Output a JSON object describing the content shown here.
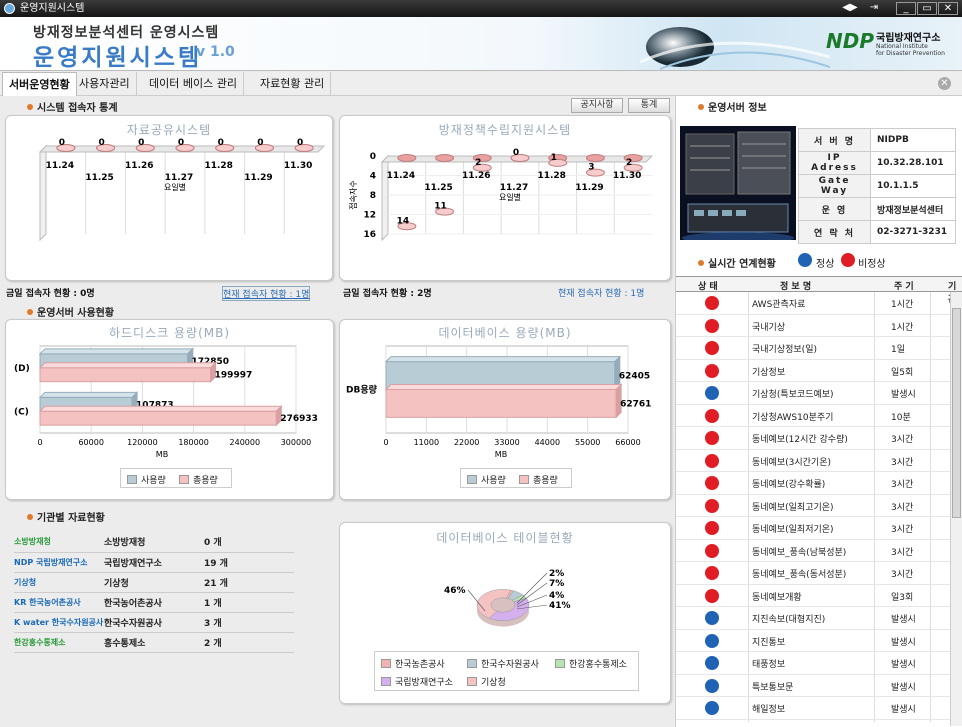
{
  "window": {
    "title": "운영지원시스템",
    "controls": [
      "◀▶",
      "⇥",
      "_",
      "▭",
      "✕"
    ]
  },
  "header": {
    "subtitle": "방재정보분석센터 운영시스템",
    "title": "운영지원시스템",
    "version": "v 1.0",
    "logo_text": "NDP",
    "org_ko": "국립방재연구소",
    "org_en1": "National Institute",
    "org_en2": "for Disaster Prevention"
  },
  "tabs": [
    "서버운영현황",
    "사용자관리",
    "데이터 베이스 관리",
    "자료현황 관리"
  ],
  "access": {
    "section": "시스템 접속자 통계",
    "btn_notice": "공지사항",
    "btn_stats": "통계",
    "left_today": "금일 접속자 현황 : 0명",
    "left_current": "현재 접속자 현황 : 1명",
    "right_today": "금일 접속자 현황 : 2명",
    "right_current": "현재 접속자 현황 : 1명"
  },
  "usage": {
    "section": "운영서버 사용현황"
  },
  "orgs_section": "기관별 자료현황",
  "orgs": [
    {
      "logo": "소방방재청",
      "name": "소방방재청",
      "count": "0 개",
      "color": "#2a9a3a"
    },
    {
      "logo": "NDP 국립방재연구소",
      "name": "국립방재연구소",
      "count": "19 개",
      "color": "#1a6ab5"
    },
    {
      "logo": "기상청",
      "name": "기상청",
      "count": "21 개",
      "color": "#1a6ab5"
    },
    {
      "logo": "KR 한국농어촌공사",
      "name": "한국농어촌공사",
      "count": "1 개",
      "color": "#1a6ab5"
    },
    {
      "logo": "K water 한국수자원공사",
      "name": "한국수자원공사",
      "count": "3 개",
      "color": "#1a6ab5"
    },
    {
      "logo": "한강홍수통제소",
      "name": "홍수통제소",
      "count": "2 개",
      "color": "#2a9a3a"
    }
  ],
  "server": {
    "section": "운영서버 정보",
    "fields": [
      {
        "k": "서 버 명",
        "v": "NIDPB"
      },
      {
        "k": "IP Adress",
        "v": "10.32.28.101"
      },
      {
        "k": "Gate Way",
        "v": "10.1.1.5"
      },
      {
        "k": "운  영",
        "v": "방재정보분석센터"
      },
      {
        "k": "연 락 처",
        "v": "02-3271-3231"
      }
    ]
  },
  "realtime": {
    "section": "실시간 연계현황",
    "normal": "정상",
    "abnormal": "비정상",
    "headers": [
      "상 태",
      "정 보 명",
      "주 기",
      "기 관"
    ],
    "rows": [
      {
        "s": "red",
        "n": "AWS관측자료",
        "c": "1시간"
      },
      {
        "s": "red",
        "n": "국내기상",
        "c": "1시간"
      },
      {
        "s": "red",
        "n": "국내기상정보(일)",
        "c": "1일"
      },
      {
        "s": "red",
        "n": "기상정보",
        "c": "일5회"
      },
      {
        "s": "blue",
        "n": "기상청(특보코드예보)",
        "c": "발생시"
      },
      {
        "s": "red",
        "n": "기상청AWS10분주기",
        "c": "10분"
      },
      {
        "s": "red",
        "n": "동네예보(12시간 강수량)",
        "c": "3시간"
      },
      {
        "s": "red",
        "n": "동네예보(3시간기온)",
        "c": "3시간"
      },
      {
        "s": "red",
        "n": "동네예보(강수확률)",
        "c": "3시간"
      },
      {
        "s": "red",
        "n": "동네예보(일최고기온)",
        "c": "3시간"
      },
      {
        "s": "red",
        "n": "동네예보(일최저기온)",
        "c": "3시간"
      },
      {
        "s": "red",
        "n": "동네예보_풍속(남북성분)",
        "c": "3시간"
      },
      {
        "s": "red",
        "n": "동네예보_풍속(동서성분)",
        "c": "3시간"
      },
      {
        "s": "red",
        "n": "동네예보개황",
        "c": "일3회"
      },
      {
        "s": "blue",
        "n": "지진속보(대형지진)",
        "c": "발생시"
      },
      {
        "s": "blue",
        "n": "지진통보",
        "c": "발생시"
      },
      {
        "s": "blue",
        "n": "태풍정보",
        "c": "발생시"
      },
      {
        "s": "blue",
        "n": "특보통보문",
        "c": "발생시"
      },
      {
        "s": "blue",
        "n": "해일정보",
        "c": "발생시"
      }
    ]
  },
  "colors": {
    "red": "#e01c24",
    "blue": "#2062b4",
    "accent": "#e07a2a"
  },
  "chart_data": [
    {
      "type": "bar",
      "title": "자료공유시스템",
      "categories": [
        "11.24",
        "11.25",
        "11.26",
        "11.27",
        "11.28",
        "11.29",
        "11.30"
      ],
      "values": [
        0,
        0,
        0,
        0,
        0,
        0,
        0
      ],
      "xlabel": "요일별",
      "ylabel": "",
      "ylim": [
        0,
        16
      ]
    },
    {
      "type": "bar",
      "title": "방재정책수립지원시스템",
      "categories": [
        "11.24",
        "11.25",
        "11.26",
        "11.27",
        "11.28",
        "11.29",
        "11.30"
      ],
      "values": [
        14,
        11,
        2,
        0,
        1,
        3,
        2
      ],
      "xlabel": "요일별",
      "ylabel": "접속자수",
      "yticks": [
        0,
        4,
        8,
        12,
        16
      ],
      "ylim": [
        0,
        16
      ]
    },
    {
      "type": "bar",
      "orientation": "horizontal",
      "title": "하드디스크 용량(MB)",
      "categories": [
        "(D)",
        "(C)"
      ],
      "series": [
        {
          "name": "사용량",
          "values": [
            172850,
            107873
          ]
        },
        {
          "name": "총용량",
          "values": [
            199997,
            276933
          ]
        }
      ],
      "xlabel": "MB",
      "xticks": [
        0,
        60000,
        120000,
        180000,
        240000,
        300000
      ],
      "xlim": [
        0,
        300000
      ]
    },
    {
      "type": "bar",
      "orientation": "horizontal",
      "title": "데이터베이스 용량(MB)",
      "categories": [
        "DB용량"
      ],
      "series": [
        {
          "name": "사용량",
          "values": [
            62405
          ]
        },
        {
          "name": "총용량",
          "values": [
            62761
          ]
        }
      ],
      "xlabel": "MB",
      "xticks": [
        0,
        11000,
        22000,
        33000,
        44000,
        55000,
        66000
      ],
      "xlim": [
        0,
        66000
      ]
    },
    {
      "type": "pie",
      "title": "데이터베이스 테이블현황",
      "labels": [
        "한국농촌공사",
        "한국수자원공사",
        "한강홍수통제소",
        "국립방재연구소",
        "기상청"
      ],
      "values": [
        2,
        7,
        4,
        41,
        46
      ],
      "label_texts": [
        "2%",
        "7%",
        "4%",
        "41%",
        "46%"
      ],
      "colors": [
        "#f4b3b3",
        "#b8ccd6",
        "#b9e3b5",
        "#d4b0ee",
        "#f5c2c2"
      ]
    }
  ]
}
